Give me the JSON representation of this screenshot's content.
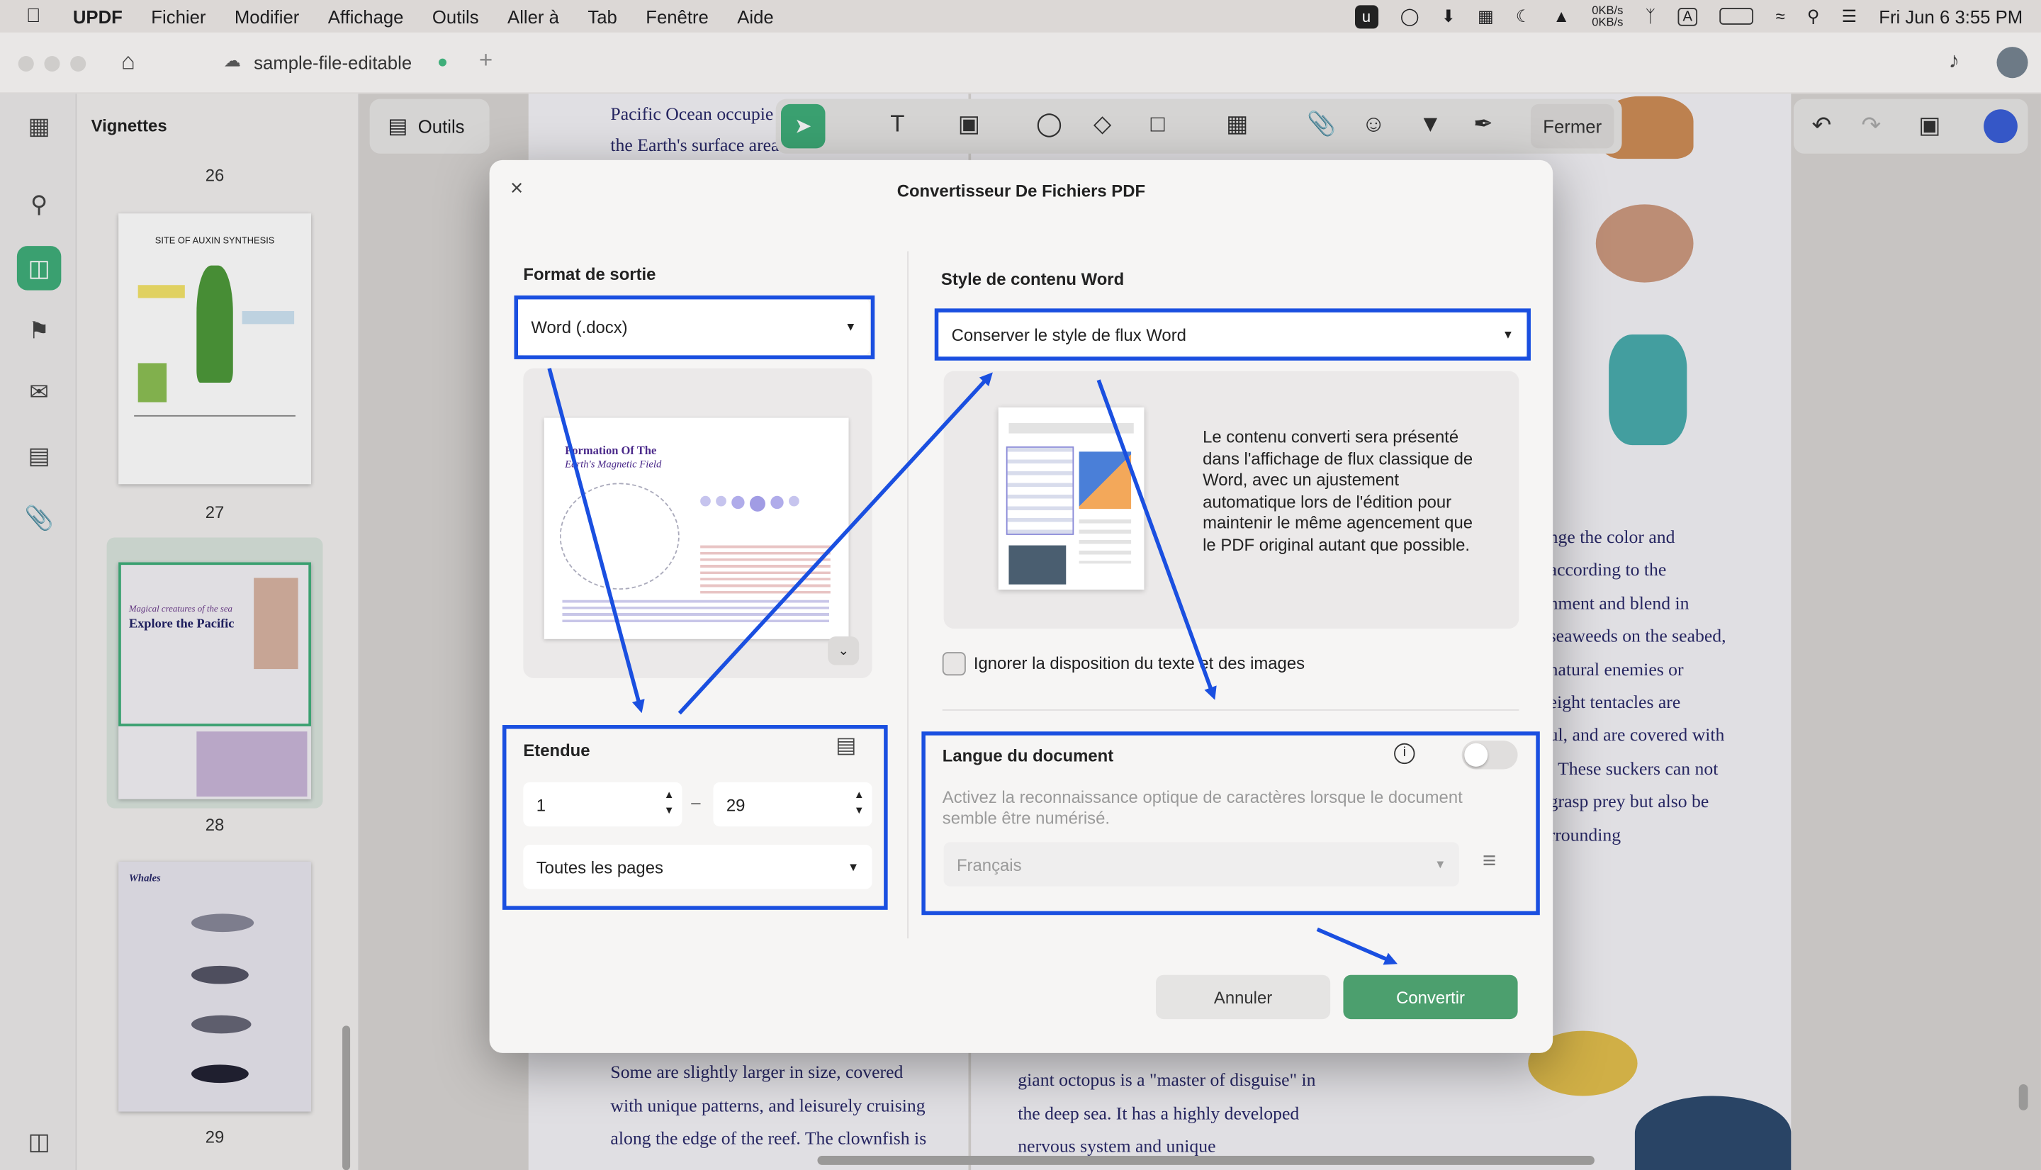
{
  "menubar": {
    "app": "UPDF",
    "items": [
      "Fichier",
      "Modifier",
      "Affichage",
      "Outils",
      "Aller à",
      "Tab",
      "Fenêtre",
      "Aide"
    ],
    "net_up": "0KB/s",
    "net_down": "0KB/s",
    "datetime": "Fri Jun 6  3:55 PM"
  },
  "tab": {
    "title": "sample-file-editable"
  },
  "sidebar": {
    "title": "Vignettes",
    "pages": [
      "26",
      "27",
      "28",
      "29"
    ],
    "thumb27_title": "SITE OF AUXIN SYNTHESIS",
    "thumb28_title": "Explore the Pacific",
    "thumb28_sub": "Magical creatures of the sea",
    "thumb29_title": "Whales"
  },
  "toolbar": {
    "tools_label": "Outils",
    "close_label": "Fermer"
  },
  "document": {
    "top_left": [
      "Pacific Ocean occupie",
      "the Earth's surface area"
    ],
    "right_col": [
      "nge the color and",
      "according to the",
      "nment and blend in",
      "seaweeds on the seabed,",
      "natural enemies or",
      " eight tentacles are",
      "ul, and are covered with",
      ". These suckers can not",
      "grasp prey but also be",
      "rrounding"
    ],
    "bottom_left": [
      "Some are slightly larger in size, covered",
      "with unique patterns, and leisurely cruising",
      "along the edge of the reef. The clownfish is"
    ],
    "bottom_mid": [
      "giant octopus is a \"master of disguise\" in",
      "the deep sea. It has a highly developed",
      "nervous system and unique"
    ]
  },
  "dialog": {
    "title": "Convertisseur De Fichiers PDF",
    "close": "×",
    "format": {
      "label": "Format de sortie",
      "value": "Word (.docx)"
    },
    "preview_title_1": "Formation Of The",
    "preview_title_2": "Earth's Magnetic Field",
    "range": {
      "label": "Etendue",
      "from": "1",
      "to": "29",
      "dash": "–",
      "pages": "Toutes les pages"
    },
    "style": {
      "label": "Style de contenu Word",
      "value": "Conserver le style de flux Word",
      "description": "Le contenu converti sera présenté dans l'affichage de flux classique de Word, avec un ajustement automatique lors de l'édition pour maintenir le même agencement que le PDF original autant que possible."
    },
    "ignore_layout": "Ignorer la disposition du texte et des images",
    "language": {
      "label": "Langue du document",
      "hint": "Activez la reconnaissance optique de caractères lorsque le document semble être numérisé.",
      "value": "Français",
      "ocr_enabled": false
    },
    "cancel": "Annuler",
    "convert": "Convertir"
  },
  "colors": {
    "accent": "#3fae7a",
    "highlight": "#1a4fe0",
    "convert": "#4c9f6e"
  }
}
